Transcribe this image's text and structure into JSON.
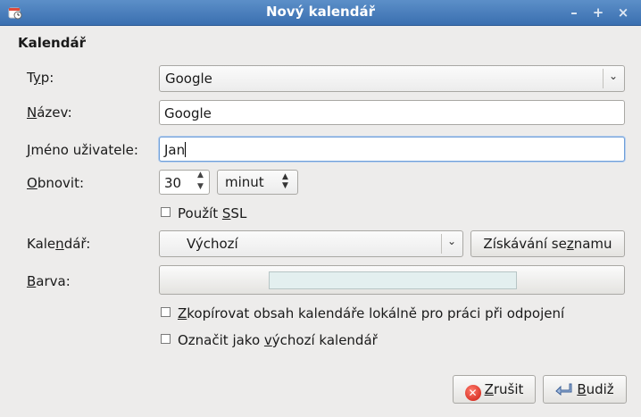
{
  "window": {
    "title": "Nový kalendář",
    "controls": [
      "–",
      "+",
      "×"
    ]
  },
  "section_title": "Kalendář",
  "form": {
    "typ_label_pre": "T",
    "typ_label_u": "y",
    "typ_label_post": "p:",
    "typ_value": "Google",
    "nazev_label_u": "N",
    "nazev_label_post": "ázev:",
    "nazev_value": "Google",
    "jmeno_label_u": "J",
    "jmeno_label_post": "méno uživatele:",
    "jmeno_value": "Jan",
    "obnovit_label_u": "O",
    "obnovit_label_post": "bnovit:",
    "obnovit_value": "30",
    "obnovit_unit": "minut",
    "ssl_label_pre": "Použít ",
    "ssl_label_u": "S",
    "ssl_label_post": "SL",
    "kalendar_label_pre": "Kale",
    "kalendar_label_u": "n",
    "kalendar_label_post": "dář:",
    "kalendar_value": "Výchozí",
    "ziskavani_pre": "Získávání se",
    "ziskavani_u": "z",
    "ziskavani_post": "namu",
    "barva_label_u": "B",
    "barva_label_post": "arva:",
    "barva_color": "#e3efef",
    "copy_label_u": "Z",
    "copy_label_post": "kopírovat obsah kalendáře lokálně pro práci při odpojení",
    "default_label_pre": "Označit jako ",
    "default_label_u": "v",
    "default_label_post": "ýchozí kalendář"
  },
  "buttons": {
    "cancel_u": "Z",
    "cancel_post": "rušit",
    "ok_u": "B",
    "ok_post": "udiž"
  }
}
